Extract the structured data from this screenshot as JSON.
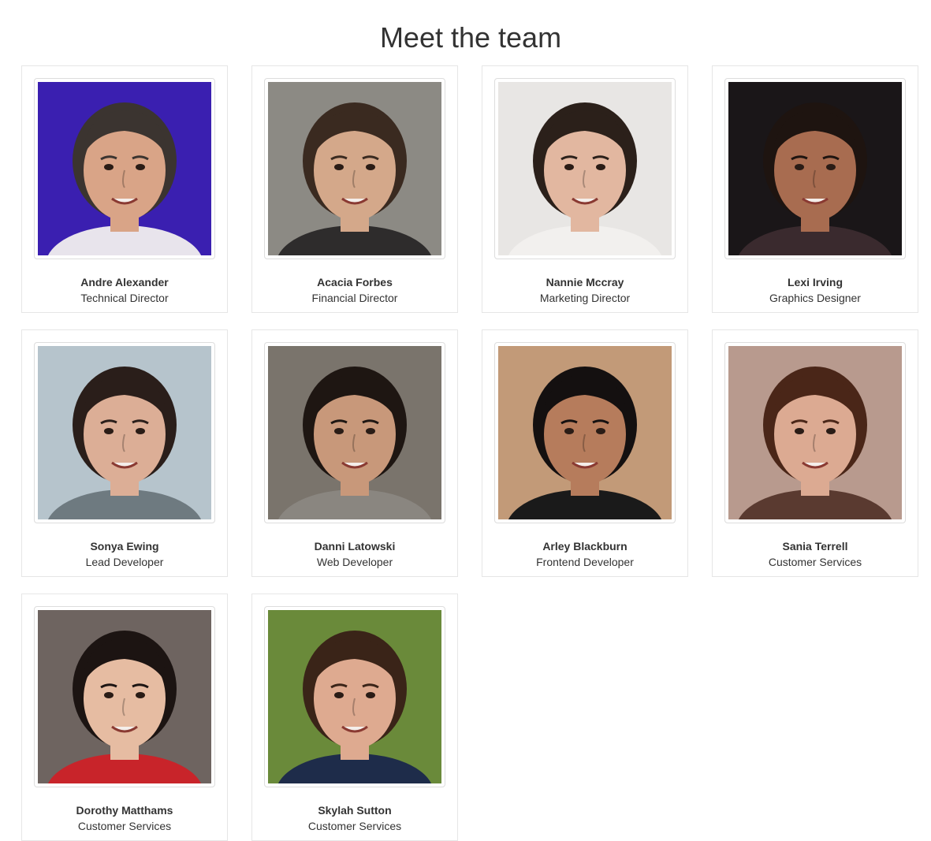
{
  "page": {
    "title": "Meet the team"
  },
  "team": [
    {
      "name": "Andre Alexander",
      "role": "Technical Director",
      "photo": "portrait-photo",
      "bg": "#3a1fb0",
      "skin": "#d9a487",
      "hair": "#3b3430",
      "shirt": "#e8e4ec"
    },
    {
      "name": "Acacia Forbes",
      "role": "Financial Director",
      "photo": "portrait-photo",
      "bg": "#8c8a84",
      "skin": "#d4a88a",
      "hair": "#3a2a20",
      "shirt": "#2e2c2c"
    },
    {
      "name": "Nannie Mccray",
      "role": "Marketing Director",
      "photo": "portrait-photo",
      "bg": "#e8e6e4",
      "skin": "#e2b7a0",
      "hair": "#2b201a",
      "shirt": "#f2f0ee"
    },
    {
      "name": "Lexi Irving",
      "role": "Graphics Designer",
      "photo": "portrait-photo",
      "bg": "#1a1618",
      "skin": "#a86c50",
      "hair": "#1e1410",
      "shirt": "#3a2a2e"
    },
    {
      "name": "Sonya Ewing",
      "role": "Lead Developer",
      "photo": "portrait-photo",
      "bg": "#b6c4cc",
      "skin": "#dcae96",
      "hair": "#2a1e1a",
      "shirt": "#6e7a80"
    },
    {
      "name": "Danni Latowski",
      "role": "Web Developer",
      "photo": "portrait-photo",
      "bg": "#7a746c",
      "skin": "#c8987a",
      "hair": "#1e1612",
      "shirt": "#8a8680"
    },
    {
      "name": "Arley Blackburn",
      "role": "Frontend Developer",
      "photo": "portrait-photo",
      "bg": "#c29a78",
      "skin": "#b67c5c",
      "hair": "#141010",
      "shirt": "#1a1a1a"
    },
    {
      "name": "Sania Terrell",
      "role": "Customer Services",
      "photo": "portrait-photo",
      "bg": "#b89a8e",
      "skin": "#dcaa92",
      "hair": "#4a2618",
      "shirt": "#5a3a30"
    },
    {
      "name": "Dorothy Matthams",
      "role": "Customer Services",
      "photo": "portrait-photo",
      "bg": "#6e6460",
      "skin": "#e6bca2",
      "hair": "#1c1412",
      "shirt": "#c8242a"
    },
    {
      "name": "Skylah Sutton",
      "role": "Customer Services",
      "photo": "portrait-photo",
      "bg": "#6a8a3a",
      "skin": "#deaa90",
      "hair": "#3a2418",
      "shirt": "#1e2c4a"
    }
  ]
}
